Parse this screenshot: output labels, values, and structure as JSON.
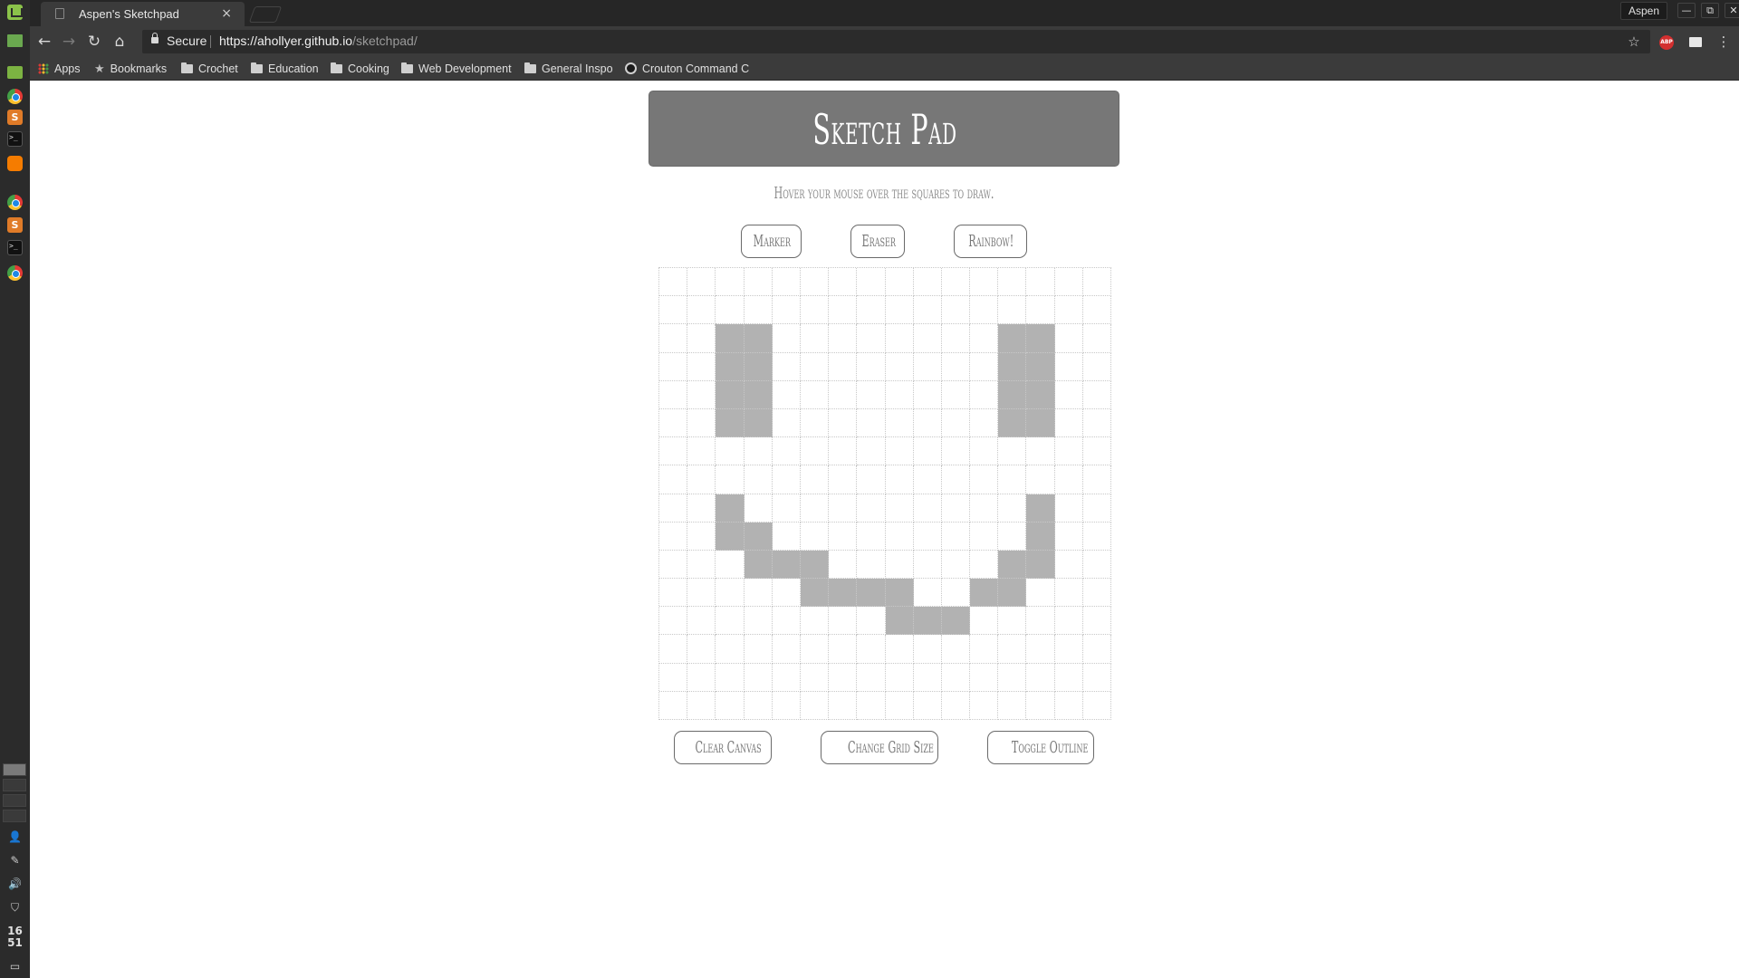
{
  "taskbar": {
    "clock_hour": "16",
    "clock_minute": "51"
  },
  "browser": {
    "tab_title": "Aspen's Sketchpad",
    "tab_close": "×",
    "profile_name": "Aspen",
    "window_buttons": [
      "—",
      "⧉",
      "✕"
    ],
    "secure_label": "Secure",
    "url_host": "https://ahollyer.github.io",
    "url_path": "/sketchpad/",
    "abp_label": "ABP"
  },
  "bookmarks": [
    {
      "label": "Apps",
      "icon": "apps-icon"
    },
    {
      "label": "Bookmarks",
      "icon": "star-icon"
    },
    {
      "label": "Crochet",
      "icon": "folder-icon"
    },
    {
      "label": "Education",
      "icon": "folder-icon"
    },
    {
      "label": "Cooking",
      "icon": "folder-icon"
    },
    {
      "label": "Web Development",
      "icon": "folder-icon"
    },
    {
      "label": "General Inspo",
      "icon": "folder-icon"
    },
    {
      "label": "Crouton Command C",
      "icon": "github-icon"
    }
  ],
  "page": {
    "title": "Sketch Pad",
    "instructions": "Hover your mouse over the squares to draw.",
    "mode_buttons": {
      "marker": "Marker",
      "eraser": "Eraser",
      "rainbow": "Rainbow!"
    },
    "action_buttons": {
      "clear": "Clear Canvas",
      "grid_size": "Change Grid Size",
      "outline": "Toggle Outline"
    }
  },
  "grid": {
    "rows": 16,
    "cols": 16,
    "fill_color": "#b2b2b2",
    "filled_cells": [
      [
        2,
        2
      ],
      [
        2,
        3
      ],
      [
        2,
        12
      ],
      [
        2,
        13
      ],
      [
        3,
        2
      ],
      [
        3,
        3
      ],
      [
        3,
        12
      ],
      [
        3,
        13
      ],
      [
        4,
        2
      ],
      [
        4,
        3
      ],
      [
        4,
        12
      ],
      [
        4,
        13
      ],
      [
        5,
        2
      ],
      [
        5,
        3
      ],
      [
        5,
        12
      ],
      [
        5,
        13
      ],
      [
        8,
        2
      ],
      [
        8,
        13
      ],
      [
        9,
        2
      ],
      [
        9,
        3
      ],
      [
        9,
        13
      ],
      [
        10,
        3
      ],
      [
        10,
        4
      ],
      [
        10,
        5
      ],
      [
        10,
        12
      ],
      [
        10,
        13
      ],
      [
        11,
        5
      ],
      [
        11,
        6
      ],
      [
        11,
        7
      ],
      [
        11,
        8
      ],
      [
        11,
        11
      ],
      [
        11,
        12
      ],
      [
        12,
        8
      ],
      [
        12,
        9
      ],
      [
        12,
        10
      ]
    ]
  }
}
